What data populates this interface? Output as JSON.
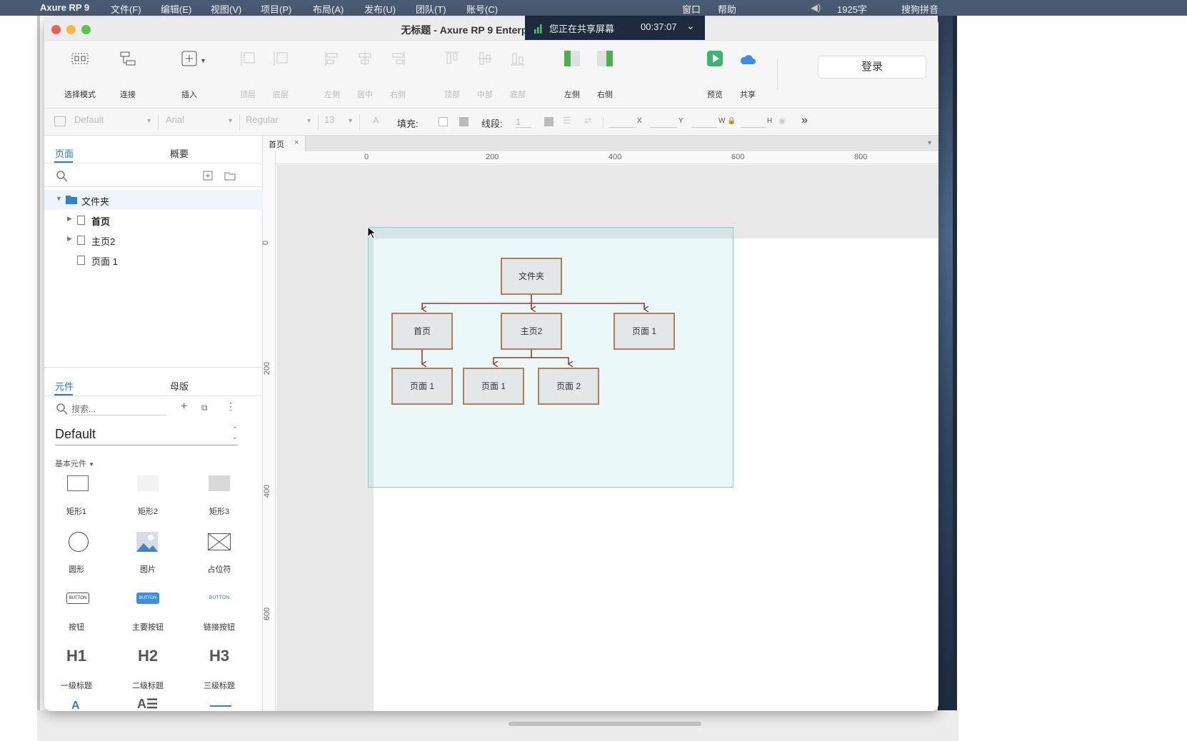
{
  "menubar": {
    "app": "Axure RP 9",
    "items": [
      "文件(F)",
      "编辑(E)",
      "视图(V)",
      "项目(P)",
      "布局(A)",
      "发布(U)",
      "团队(T)",
      "账号(C)"
    ],
    "right_items": [
      "窗口",
      "帮助",
      "1925字",
      "搜狗拼音"
    ]
  },
  "share_banner": {
    "text": "您正在共享屏幕",
    "timer": "00:37:07"
  },
  "window": {
    "title": "无标题 - Axure RP 9 Enterprise Edition"
  },
  "toolbar": {
    "items": [
      {
        "label": "选择模式",
        "icon": "select-mode-icon",
        "enabled": true
      },
      {
        "label": "连接",
        "icon": "connect-icon",
        "enabled": true
      },
      {
        "label": "插入",
        "icon": "insert-icon",
        "enabled": true
      },
      {
        "label": "顶层",
        "icon": "bring-to-front-icon",
        "enabled": false
      },
      {
        "label": "底层",
        "icon": "send-to-back-icon",
        "enabled": false
      },
      {
        "label": "左侧",
        "icon": "align-left-icon",
        "enabled": false
      },
      {
        "label": "居中",
        "icon": "align-center-icon",
        "enabled": false
      },
      {
        "label": "右侧",
        "icon": "align-right-icon",
        "enabled": false
      },
      {
        "label": "顶部",
        "icon": "align-top-icon",
        "enabled": false
      },
      {
        "label": "中部",
        "icon": "align-middle-icon",
        "enabled": false
      },
      {
        "label": "底部",
        "icon": "align-bottom-icon",
        "enabled": false
      },
      {
        "label": "左侧",
        "icon": "left-panel-icon",
        "enabled": true
      },
      {
        "label": "右侧",
        "icon": "right-panel-icon",
        "enabled": true
      },
      {
        "label": "预览",
        "icon": "preview-icon",
        "enabled": true
      },
      {
        "label": "共享",
        "icon": "share-cloud-icon",
        "enabled": true
      }
    ],
    "login_label": "登录"
  },
  "formatbar": {
    "style": "Default",
    "font": "Arial",
    "weight": "Regular",
    "size": "13",
    "fill_label": "填充:",
    "stroke_label": "线段:",
    "stroke_value": "1",
    "x_label": "X",
    "y_label": "Y",
    "w_label": "W",
    "h_label": "H"
  },
  "pages_panel": {
    "tabs": [
      "页面",
      "概要"
    ],
    "tree": [
      {
        "label": "文件夹",
        "type": "folder",
        "expanded": true
      },
      {
        "label": "首页",
        "type": "page",
        "collapsed": true
      },
      {
        "label": "主页2",
        "type": "page",
        "collapsed": true
      },
      {
        "label": "页面 1",
        "type": "page"
      }
    ]
  },
  "widgets_panel": {
    "tabs": [
      "元件",
      "母版"
    ],
    "search_placeholder": "搜索...",
    "library": "Default",
    "category": "基本元件",
    "items": [
      {
        "label": "矩形1",
        "icon": "rectangle1-icon"
      },
      {
        "label": "矩形2",
        "icon": "rectangle2-icon"
      },
      {
        "label": "矩形3",
        "icon": "rectangle3-icon"
      },
      {
        "label": "圆形",
        "icon": "circle-icon"
      },
      {
        "label": "图片",
        "icon": "image-icon"
      },
      {
        "label": "占位符",
        "icon": "placeholder-icon"
      },
      {
        "label": "按钮",
        "icon": "button-icon"
      },
      {
        "label": "主要按钮",
        "icon": "primary-button-icon"
      },
      {
        "label": "链接按钮",
        "icon": "link-button-icon"
      },
      {
        "label": "一级标题",
        "icon": "heading1-icon"
      },
      {
        "label": "二级标题",
        "icon": "heading2-icon"
      },
      {
        "label": "三级标题",
        "icon": "heading3-icon"
      }
    ],
    "button_icon_text": "BUTTON",
    "heading_icon_texts": [
      "H1",
      "H2",
      "H3"
    ]
  },
  "canvas": {
    "tab": "首页",
    "ruler_h": [
      "0",
      "200",
      "400",
      "600",
      "800"
    ],
    "ruler_v": [
      "0",
      "200",
      "400",
      "600"
    ],
    "diagram_nodes": [
      "文件夹",
      "首页",
      "主页2",
      "页面 1",
      "页面 1",
      "页面 1",
      "页面 2"
    ],
    "selection_color": "#5fc9c0",
    "connector_color": "#8b3a3a"
  }
}
